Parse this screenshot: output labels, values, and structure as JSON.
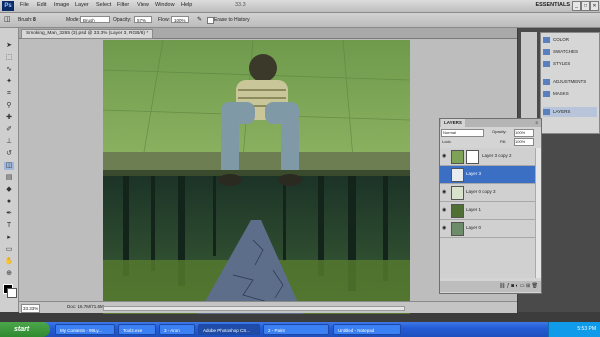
{
  "menubar": {
    "logo": "Ps",
    "items": [
      "File",
      "Edit",
      "Image",
      "Layer",
      "Select",
      "Filter",
      "View",
      "Window",
      "Help"
    ],
    "zoom_readout": "33.3",
    "workspace": "ESSENTIALS",
    "window_buttons": [
      "_",
      "□",
      "✕"
    ]
  },
  "options_bar": {
    "brush_label": "Brush:",
    "brush_size": "8",
    "mode_label": "Mode:",
    "mode_value": "Brush",
    "opacity_label": "Opacity:",
    "opacity_value": "57%",
    "flow_label": "Flow:",
    "flow_value": "100%",
    "erase_history_label": "Erase to History"
  },
  "document": {
    "tab_title": "Smoking_Man_3265 (3).psd @ 33.3% (Layer 3, RGB/8) *",
    "zoom": "33.33%",
    "doc_info": "Doc: 16.7M/71.6M"
  },
  "dock": {
    "items": [
      {
        "label": "COLOR"
      },
      {
        "label": "SWATCHES"
      },
      {
        "label": "STYLES"
      },
      {
        "label": "ADJUSTMENTS"
      },
      {
        "label": "MASKS"
      },
      {
        "label": "LAYERS"
      }
    ]
  },
  "layers_panel": {
    "tab": "LAYERS",
    "blend_mode": "Normal",
    "opacity_label": "Opacity:",
    "opacity_value": "100%",
    "fill_label": "Fill:",
    "fill_value": "100%",
    "lock_label": "Lock:",
    "layers": [
      {
        "name": "Layer 3 copy 2",
        "selected": false,
        "visible": true,
        "has_mask": true
      },
      {
        "name": "Layer 3",
        "selected": true,
        "visible": false,
        "has_mask": false
      },
      {
        "name": "Layer 0 copy 3",
        "selected": false,
        "visible": true,
        "has_mask": false
      },
      {
        "name": "Layer 1",
        "selected": false,
        "visible": true,
        "has_mask": false
      },
      {
        "name": "Layer 0",
        "selected": false,
        "visible": true,
        "has_mask": false
      }
    ]
  },
  "taskbar": {
    "start_label": "start",
    "items": [
      {
        "label": "My Contests - 99Ly..."
      },
      {
        "label": "Tool2.exe"
      },
      {
        "label": "3 - Aron"
      },
      {
        "label": "Adobe Photoshop CS..."
      },
      {
        "label": "2 - Paint"
      },
      {
        "label": "Untitled - Notepad"
      }
    ],
    "clock": "5:53 PM"
  },
  "colors": {
    "selection_blue": "#3a6fc4",
    "taskbar_blue": "#245dd6",
    "start_green": "#2f8a2f"
  }
}
